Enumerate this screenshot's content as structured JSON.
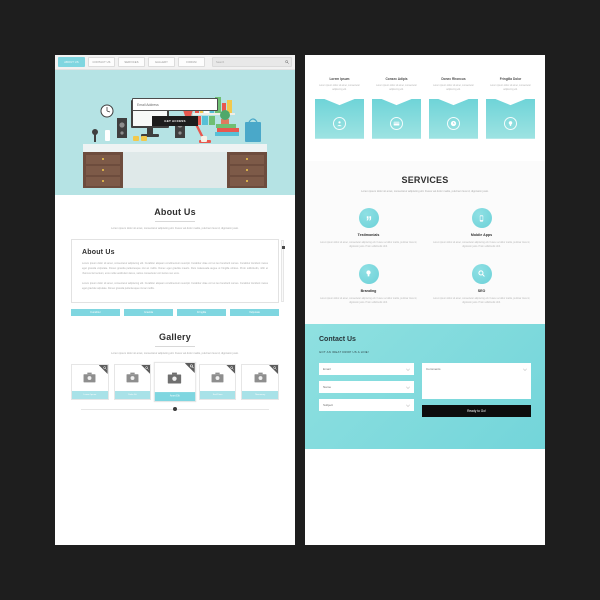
{
  "meta": {
    "background_color": "#1e1e1e",
    "accent_color": "#7fd6e0",
    "dark_color": "#1c1c1c"
  },
  "left_page": {
    "nav": {
      "items": [
        {
          "label": "ABOUT US",
          "active": true
        },
        {
          "label": "CONTACT US",
          "active": false
        },
        {
          "label": "SERVICES",
          "active": false
        },
        {
          "label": "GALLERY",
          "active": false
        },
        {
          "label": "FORUM",
          "active": false
        }
      ],
      "search_placeholder": "Search",
      "search_icon": "search-icon"
    },
    "hero": {
      "email_placeholder": "Email Address",
      "cta_label": "GET ACCESS",
      "illustration": "desk-workspace-illustration"
    },
    "about": {
      "title": "About Us",
      "subtitle": "Lorem ipsum dolor sit amet, consectetur adipiscing elit. Fusce vel dolor mattis, pulvinar risus id, dignissim justo.",
      "card_title": "About Us",
      "paragraph_1": "Lorem ipsum dolor sit amet, consectetur adipiscing elit. Curabitur aliquam condimentum suscipit. Curabitur vitae orci et leo hendrerit cursus. Curabitur tincidunt metus eget gravida vulputate. Donec gravida pellentesque nisi ac mollis. Donec eget gravida mauris. Duis malesuada augue ut fringilla ultrices. Proin sollicitudin, nibh et rhoncus fermentum, eros nulla vestibulum lacus, varius consectetur orci lectus nec eros.",
      "paragraph_2": "Lorem ipsum dolor sit amet, consectetur adipiscing elit. Curabitur aliquam condimentum suscipit. Curabitur vitae orci et leo hendrerit cursus. Curabitur tincidunt metus eget gravida vulputate. Donec gravida pellentesque nisi ac mollis.",
      "buttons": [
        "Curabitur",
        "Gravida",
        "Fringilla",
        "Vulputate"
      ]
    },
    "gallery": {
      "title": "Gallery",
      "subtitle": "Lorem ipsum dolor sit amet, consectetur adipiscing elit. Fusce vel dolor mattis, pulvinar risus id, dignissim justo.",
      "items": [
        {
          "caption": "Lorem Ipsum"
        },
        {
          "caption": "Dolor Sit"
        },
        {
          "caption": "Amet Elit"
        },
        {
          "caption": "Sed Diam"
        },
        {
          "caption": "Nonummy"
        }
      ]
    }
  },
  "right_page": {
    "features": [
      {
        "title": "Lorem Ipsum",
        "desc": "Lorem ipsum dolor sit amet, consectetur adipiscing elit.",
        "icon": "user-icon"
      },
      {
        "title": "Consec Adipis",
        "desc": "Lorem ipsum dolor sit amet, consectetur adipiscing elit.",
        "icon": "card-icon"
      },
      {
        "title": "Donec Rhoncus",
        "desc": "Lorem ipsum dolor sit amet, consectetur adipiscing elit.",
        "icon": "clock-icon"
      },
      {
        "title": "Fringilla Dolor",
        "desc": "Lorem ipsum dolor sit amet, consectetur adipiscing elit.",
        "icon": "bulb-icon"
      }
    ],
    "services": {
      "title": "SERVICES",
      "subtitle": "Lorem ipsum dolor sit amet, consectetur adipiscing elit. Fusce vel dolor mattis, pulvinar risus id, dignissim justo.",
      "items": [
        {
          "title": "Testimonials",
          "icon": "quote-icon",
          "desc": "Lorem ipsum dolor sit amet, consectetur adipiscing elit. Fusce vel dolor mattis, pulvinar risus id, dignissim justo. Proin sollicitudin nibh."
        },
        {
          "title": "Mobile Apps",
          "icon": "mobile-icon",
          "desc": "Lorem ipsum dolor sit amet, consectetur adipiscing elit. Fusce vel dolor mattis, pulvinar risus id, dignissim justo. Proin sollicitudin nibh."
        },
        {
          "title": "Branding",
          "icon": "bulb-icon",
          "desc": "Lorem ipsum dolor sit amet, consectetur adipiscing elit. Fusce vel dolor mattis, pulvinar risus id, dignissim justo. Proin sollicitudin nibh."
        },
        {
          "title": "SEO",
          "icon": "magnifier-icon",
          "desc": "Lorem ipsum dolor sit amet, consectetur adipiscing elit. Fusce vel dolor mattis, pulvinar risus id, dignissim justo. Proin sollicitudin nibh."
        }
      ]
    },
    "contact": {
      "title": "Contact Us",
      "subtitle": "GOT AN IDEA? DROP US A LINE!",
      "email_placeholder": "Email",
      "name_placeholder": "Name",
      "subject_placeholder": "Subject",
      "comments_placeholder": "Comments",
      "submit_label": "Ready to Go!"
    }
  }
}
